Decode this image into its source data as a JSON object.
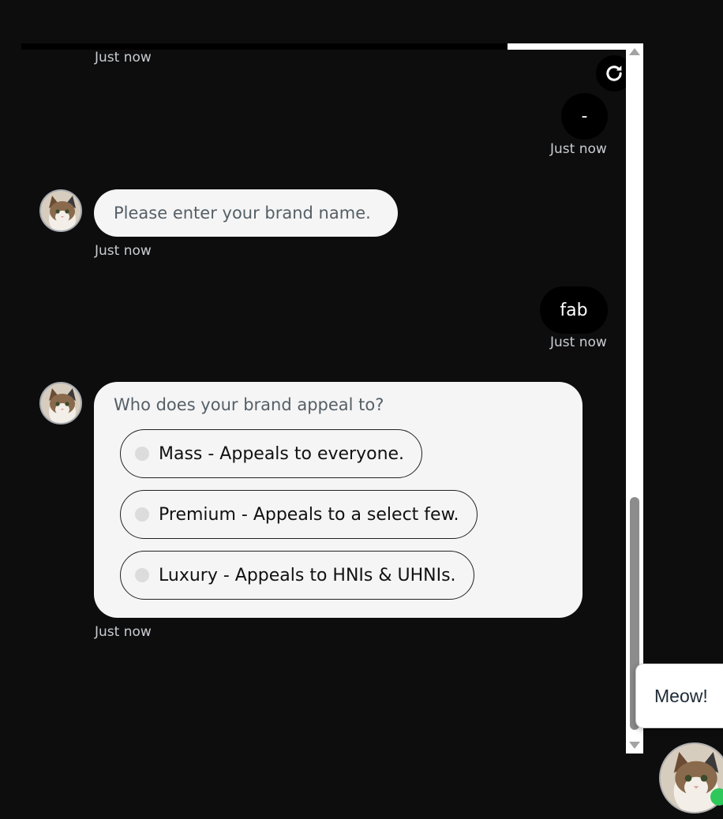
{
  "chat": {
    "timestamps": {
      "t0": "Just now",
      "t1": "Just now",
      "t2": "Just now",
      "t3": "Just now",
      "t4": "Just now"
    },
    "messages": {
      "user_dash": "-",
      "bot_brand_prompt": "Please enter your brand name.",
      "user_brand": "fab",
      "bot_question": "Who does your brand appeal to?"
    },
    "options": [
      "Mass - Appeals to everyone.",
      "Premium - Appeals to a select few.",
      "Luxury - Appeals to HNIs & UHNIs."
    ]
  },
  "widget": {
    "bubble_text": "Meow!",
    "status_color": "#2ec75a"
  },
  "icons": {
    "refresh": "refresh-icon",
    "avatar": "cat-avatar",
    "scroll_up": "scroll-up-arrow",
    "scroll_down": "scroll-down-arrow"
  },
  "colors": {
    "background": "#0d0d0d",
    "bot_bubble": "#f5f5f5",
    "user_bubble": "#000000",
    "timestamp": "#c9cdd2"
  }
}
